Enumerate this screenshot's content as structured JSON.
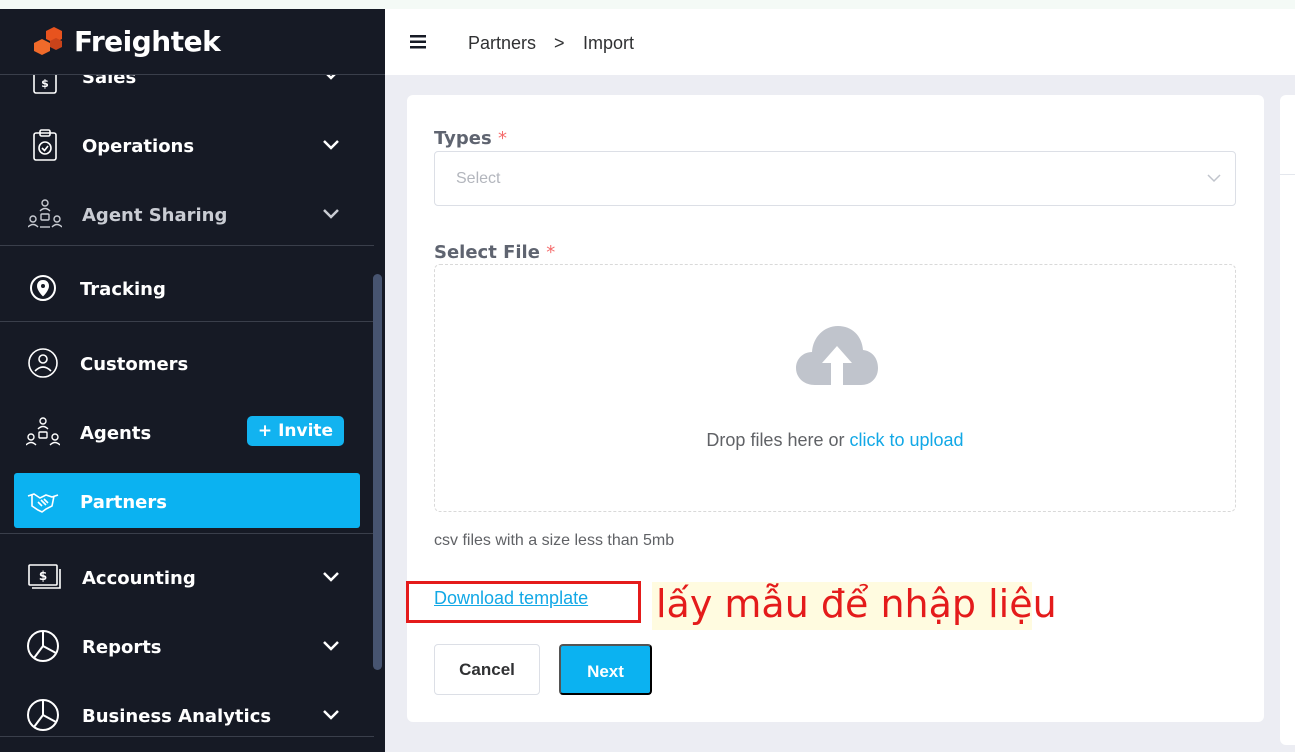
{
  "app": {
    "name": "Freightek",
    "brand_color": "#0bb2f1"
  },
  "sidebar": {
    "items": [
      {
        "label": "Sales",
        "icon": "invoice-dollar-icon",
        "has_chevron": true
      },
      {
        "label": "Operations",
        "icon": "clipboard-check-icon",
        "has_chevron": true
      },
      {
        "label": "Agent Sharing",
        "icon": "agent-network-icon",
        "has_chevron": true
      },
      {
        "label": "Tracking",
        "icon": "location-pin-icon",
        "has_chevron": false
      },
      {
        "label": "Customers",
        "icon": "customer-icon",
        "has_chevron": false
      },
      {
        "label": "Agents",
        "icon": "agents-network-icon",
        "has_chevron": false
      },
      {
        "label": "Partners",
        "icon": "handshake-icon",
        "has_chevron": false,
        "active": true
      },
      {
        "label": "Accounting",
        "icon": "money-icon",
        "has_chevron": true
      },
      {
        "label": "Reports",
        "icon": "pie-chart-icon",
        "has_chevron": true
      },
      {
        "label": "Business Analytics",
        "icon": "analytics-chart-icon",
        "has_chevron": true
      }
    ],
    "invite_label": "+ Invite"
  },
  "header": {
    "menu_icon": "hamburger-icon",
    "breadcrumb": [
      "Partners",
      ">",
      "Import"
    ]
  },
  "form": {
    "types_label": "Types",
    "required_mark": "*",
    "types_placeholder": "Select",
    "file_label": "Select File",
    "drop_text": "Drop files here or ",
    "drop_link": "click to upload",
    "upload_icon": "cloud-upload-icon",
    "hint": "csv files with a size less than 5mb",
    "download_template": "Download template",
    "cancel_label": "Cancel",
    "next_label": "Next"
  },
  "annotation": {
    "note": "lấy mẫu để nhập liệu",
    "color": "#e41b1b"
  }
}
